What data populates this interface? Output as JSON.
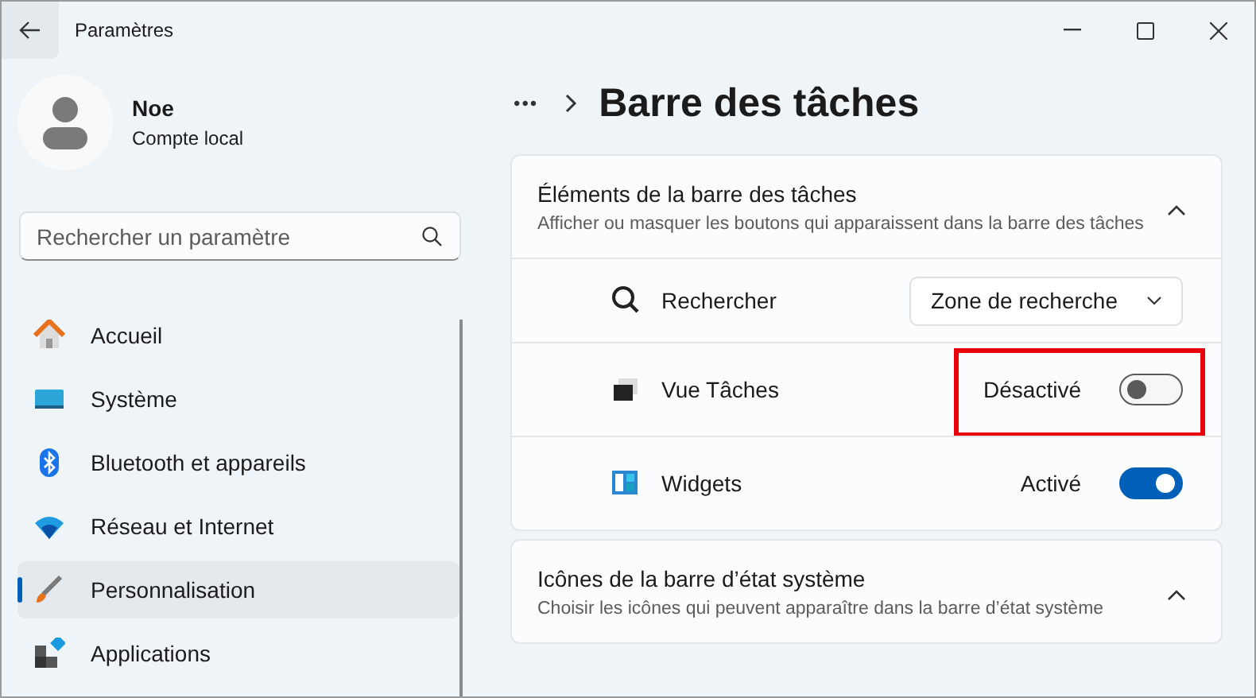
{
  "window": {
    "title": "Paramètres"
  },
  "account": {
    "name": "Noe",
    "type": "Compte local"
  },
  "search": {
    "placeholder": "Rechercher un paramètre"
  },
  "sidebar": {
    "items": [
      {
        "label": "Accueil",
        "selected": false
      },
      {
        "label": "Système",
        "selected": false
      },
      {
        "label": "Bluetooth et appareils",
        "selected": false
      },
      {
        "label": "Réseau et Internet",
        "selected": false
      },
      {
        "label": "Personnalisation",
        "selected": true
      },
      {
        "label": "Applications",
        "selected": false
      }
    ]
  },
  "breadcrumb": {
    "more": "•••",
    "title": "Barre des tâches"
  },
  "sections": [
    {
      "title": "Éléments de la barre des tâches",
      "subtitle": "Afficher ou masquer les boutons qui apparaissent dans la barre des tâches",
      "expanded": true,
      "rows": [
        {
          "kind": "dropdown",
          "label": "Rechercher",
          "value": "Zone de recherche",
          "highlighted": false
        },
        {
          "kind": "toggle",
          "label": "Vue Tâches",
          "status": "Désactivé",
          "on": false,
          "highlighted": true
        },
        {
          "kind": "toggle",
          "label": "Widgets",
          "status": "Activé",
          "on": true,
          "highlighted": false
        }
      ]
    },
    {
      "title": "Icônes de la barre d’état système",
      "subtitle": "Choisir les icônes qui peuvent apparaître dans la barre d’état système",
      "expanded": true
    }
  ]
}
